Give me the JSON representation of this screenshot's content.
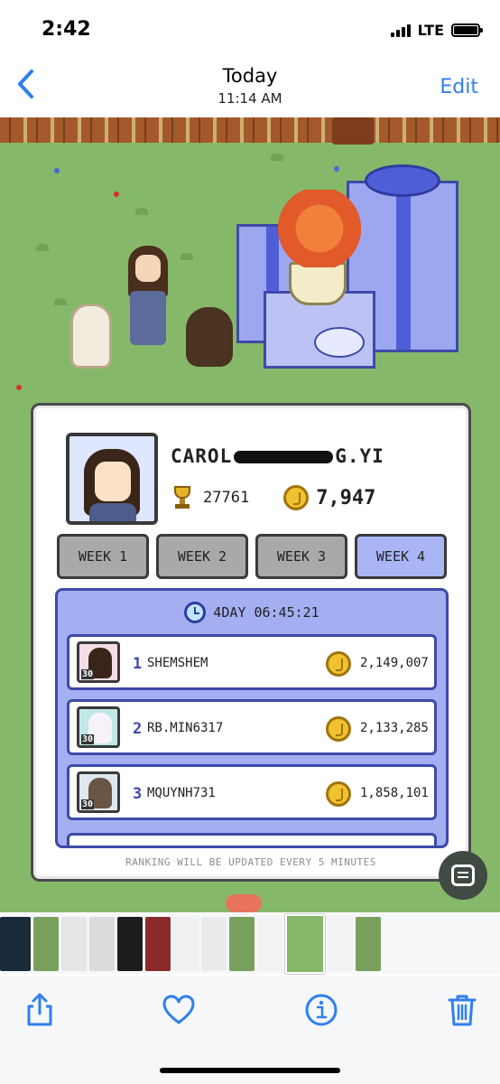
{
  "status_bar": {
    "time": "2:42",
    "network": "LTE"
  },
  "nav": {
    "back_label": "‹",
    "title": "Today",
    "subtitle": "11:14 AM",
    "edit_label": "Edit"
  },
  "profile": {
    "name_prefix": "CAROL",
    "name_suffix": "G.YI",
    "trophies": "27761",
    "coins": "7,947"
  },
  "tabs": [
    {
      "label": "WEEK 1",
      "active": false
    },
    {
      "label": "WEEK 2",
      "active": false
    },
    {
      "label": "WEEK 3",
      "active": false
    },
    {
      "label": "WEEK 4",
      "active": true
    }
  ],
  "timer": "4DAY 06:45:21",
  "leaderboard": [
    {
      "rank": "1",
      "name": "SHEMSHEM",
      "score": "2,149,007",
      "level": "30",
      "avatar_color": "#3a2618",
      "avatar_bg": "#f3dde6"
    },
    {
      "rank": "2",
      "name": "RB.MIN6317",
      "score": "2,133,285",
      "level": "30",
      "avatar_color": "#f7f2f8",
      "avatar_bg": "#bfe8e6"
    },
    {
      "rank": "3",
      "name": "MQUYNH731",
      "score": "1,858,101",
      "level": "30",
      "avatar_color": "#6a5646",
      "avatar_bg": "#dfe8ef"
    }
  ],
  "footer_note": "RANKING WILL BE UPDATED EVERY 5 MINUTES",
  "colors": {
    "accent": "#2f7ff0",
    "panel_blue": "#a3aff0",
    "grass": "#86b86a"
  },
  "thumbnails": [
    {
      "color": "#1b2a3a"
    },
    {
      "color": "#7aa05e"
    },
    {
      "color": "#e6e6e6"
    },
    {
      "color": "#dcdcdc"
    },
    {
      "color": "#1c1c1c"
    },
    {
      "color": "#8b2a2a"
    },
    {
      "color": "#f0f0f0"
    },
    {
      "color": "#ebebeb"
    },
    {
      "color": "#7aa05e"
    },
    {
      "color": "#f2f2f2"
    },
    {
      "color": "#86b86a",
      "selected": true
    },
    {
      "color": "#f2f2f2"
    },
    {
      "color": "#7aa05e"
    }
  ],
  "toolbar": {
    "share_icon": "share-icon",
    "favorite_icon": "heart-icon",
    "info_icon": "info-icon",
    "delete_icon": "trash-icon"
  }
}
